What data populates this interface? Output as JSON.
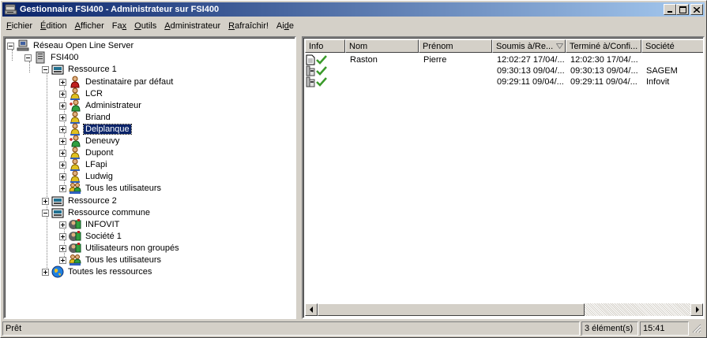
{
  "window": {
    "title": "Gestionnaire FSI400 - Administrateur sur FSI400",
    "controls": [
      "minimize",
      "maximize",
      "close"
    ]
  },
  "menu": [
    {
      "label_pre": "",
      "accel": "F",
      "label_post": "ichier"
    },
    {
      "label_pre": "",
      "accel": "É",
      "label_post": "dition"
    },
    {
      "label_pre": "",
      "accel": "A",
      "label_post": "fficher"
    },
    {
      "label_pre": "Fa",
      "accel": "x",
      "label_post": ""
    },
    {
      "label_pre": "",
      "accel": "O",
      "label_post": "utils"
    },
    {
      "label_pre": "",
      "accel": "A",
      "label_post": "dministrateur"
    },
    {
      "label_pre": "",
      "accel": "R",
      "label_post": "afraîchir!"
    },
    {
      "label_pre": "Ai",
      "accel": "d",
      "label_post": "e"
    }
  ],
  "tree": {
    "root": "Réseau Open Line Server",
    "server": "FSI400",
    "ressource1": {
      "label": "Ressource  1",
      "children": [
        {
          "label": "Destinataire par défaut",
          "icon": "user-red-icon"
        },
        {
          "label": "LCR",
          "icon": "user-icon"
        },
        {
          "label": "Administrateur",
          "icon": "user-admin-icon"
        },
        {
          "label": "Briand",
          "icon": "user-icon"
        },
        {
          "label": "Delplanque",
          "icon": "user-icon",
          "selected": true
        },
        {
          "label": "Deneuvy",
          "icon": "user-admin-icon"
        },
        {
          "label": "Dupont",
          "icon": "user-icon"
        },
        {
          "label": "LFapi",
          "icon": "user-icon"
        },
        {
          "label": "Ludwig",
          "icon": "user-icon"
        },
        {
          "label": "Tous les utilisateurs",
          "icon": "group-icon"
        }
      ]
    },
    "ressource2": {
      "label": "Ressource  2"
    },
    "ressource_commune": {
      "label": "Ressource commune",
      "children": [
        {
          "label": "INFOVIT",
          "icon": "company-icon"
        },
        {
          "label": "Société 1",
          "icon": "company-icon"
        },
        {
          "label": "Utilisateurs non groupés",
          "icon": "company-icon"
        },
        {
          "label": "Tous les utilisateurs",
          "icon": "group-icon"
        }
      ]
    },
    "all_resources": "Toutes les ressources"
  },
  "list": {
    "columns": [
      "Info",
      "Nom",
      "Prénom",
      "Soumis à/Re...",
      "Terminé à/Confi...",
      "Société"
    ],
    "rows": [
      {
        "info": "document-check",
        "nom": "Raston",
        "prenom": "Pierre",
        "soumis": "12:02:27  17/04/...",
        "termine": "12:02:30  17/04/...",
        "societe": ""
      },
      {
        "info": "fax-check",
        "nom": "",
        "prenom": "",
        "soumis": "09:30:13  09/04/...",
        "termine": "09:30:13  09/04/...",
        "societe": "SAGEM"
      },
      {
        "info": "fax-check",
        "nom": "",
        "prenom": "",
        "soumis": "09:29:11  09/04/...",
        "termine": "09:29:11  09/04/...",
        "societe": "Infovit"
      }
    ]
  },
  "status": {
    "text": "Prêt",
    "count": "3 élément(s)",
    "time": "15:41"
  },
  "colors": {
    "titlebar_start": "#0a246a",
    "titlebar_end": "#a6caf0",
    "check_green": "#3a9a2a",
    "selection": "#0a246a"
  }
}
